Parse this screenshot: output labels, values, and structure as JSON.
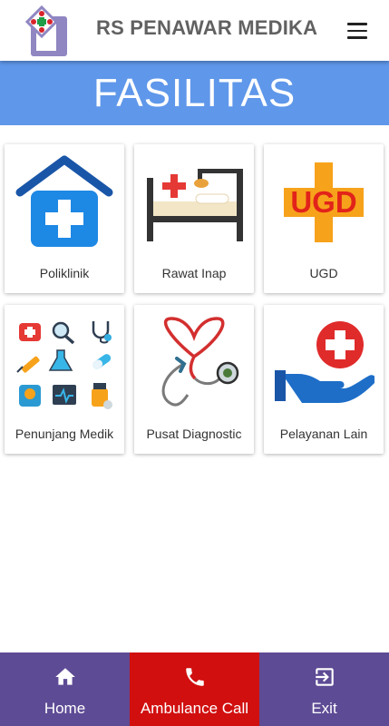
{
  "header": {
    "title": "RS PENAWAR MEDIKA"
  },
  "banner": {
    "title": "FASILITAS"
  },
  "facilities": [
    {
      "label": "Poliklinik"
    },
    {
      "label": "Rawat Inap"
    },
    {
      "label": "UGD",
      "icon_text": "UGD"
    },
    {
      "label": "Penunjang Medik"
    },
    {
      "label": "Pusat Diagnostic"
    },
    {
      "label": "Pelayanan Lain"
    }
  ],
  "bottom_nav": {
    "home": "Home",
    "ambulance": "Ambulance Call",
    "exit": "Exit"
  },
  "colors": {
    "banner": "#5f97ea",
    "nav_primary": "#5e4b95",
    "nav_emergency": "#d10f0f"
  }
}
